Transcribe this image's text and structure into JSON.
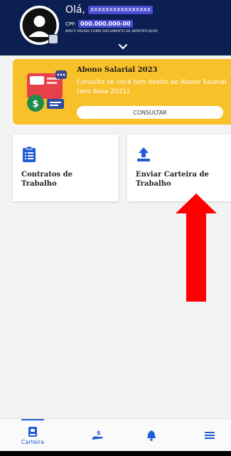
{
  "header": {
    "greeting": "Olá,",
    "user_name": "xxxxxxxxxxxxxxxx",
    "cpf_label": "CPF:",
    "cpf_value": "000.000.000-00",
    "notice": "NÃO É VÁLIDO COMO DOCUMENTO DE IDENTIFICAÇÃO"
  },
  "banner": {
    "title": "Abono Salarial 2023",
    "text": "Consulte se você tem direito ao Abono Salarial (ano base 2021).",
    "button_label": "CONSULTAR"
  },
  "cards": [
    {
      "label": "Contratos de Trabalho",
      "icon": "clipboard-list-icon"
    },
    {
      "label": "Enviar Carteira de Trabalho",
      "icon": "upload-icon"
    }
  ],
  "bottom_nav": {
    "items": [
      {
        "label": "Carteira",
        "icon": "wallet-card-icon",
        "active": true
      },
      {
        "label": "",
        "icon": "hand-money-icon",
        "active": false
      },
      {
        "label": "",
        "icon": "bell-icon",
        "active": false
      },
      {
        "label": "",
        "icon": "menu-icon",
        "active": false
      }
    ]
  },
  "colors": {
    "header_bg": "#0b1f52",
    "banner_bg": "#f8c12a",
    "accent": "#1f5cd6",
    "arrow": "#ff0000"
  }
}
